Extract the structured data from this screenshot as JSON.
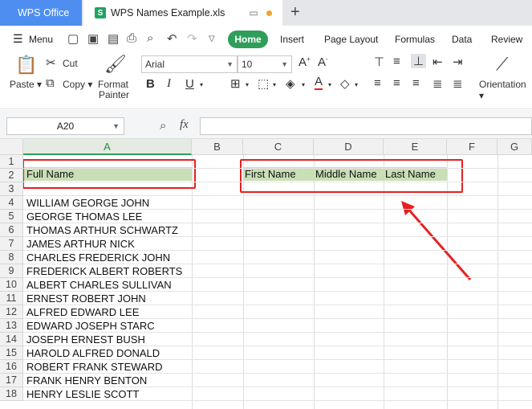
{
  "titlebar": {
    "app_tab": "WPS Office",
    "file_tab": "WPS Names Example.xls",
    "new_tab_icon": "plus-icon"
  },
  "menubar": {
    "menu_label": "Menu",
    "tabs": [
      "Home",
      "Insert",
      "Page Layout",
      "Formulas",
      "Data",
      "Review"
    ]
  },
  "ribbon": {
    "paste": "Paste",
    "cut": "Cut",
    "copy": "Copy",
    "format_painter_1": "Format",
    "format_painter_2": "Painter",
    "font_name": "Arial",
    "font_size": "10",
    "orientation": "Orientation"
  },
  "formula_bar": {
    "name_box": "A20",
    "fx": "fx",
    "value": ""
  },
  "sheet": {
    "columns": [
      "A",
      "B",
      "C",
      "D",
      "E",
      "F",
      "G"
    ],
    "rows": [
      "1",
      "2",
      "3",
      "4",
      "5",
      "6",
      "7",
      "8",
      "9",
      "10",
      "11",
      "12",
      "13",
      "14",
      "15",
      "16",
      "17",
      "18"
    ],
    "a2": "Full Name",
    "c2": "First Name",
    "d2": "Middle Name",
    "e2": "Last Name",
    "names": [
      "WILLIAM GEORGE JOHN",
      "GEORGE THOMAS LEE",
      "THOMAS ARTHUR SCHWARTZ",
      "JAMES ARTHUR NICK",
      "CHARLES FREDERICK JOHN",
      "FREDERICK ALBERT ROBERTS",
      "ALBERT CHARLES SULLIVAN",
      "ERNEST ROBERT JOHN",
      "ALFRED EDWARD LEE",
      "EDWARD JOSEPH STARC",
      "JOSEPH ERNEST BUSH",
      "HAROLD ALFRED DONALD",
      "ROBERT FRANK STEWARD",
      "FRANK HENRY BENTON",
      "HENRY LESLIE SCOTT"
    ]
  },
  "colors": {
    "accent_green": "#2f9e5a",
    "header_fill": "#c9dfb6",
    "annotation_red": "#e52020"
  }
}
